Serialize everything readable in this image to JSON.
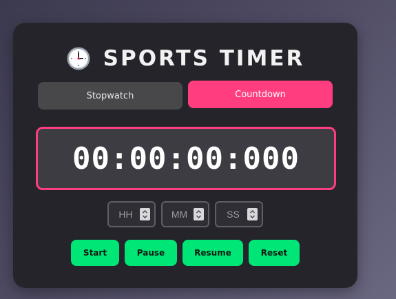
{
  "header": {
    "title": "SPORTS TIMER",
    "icon": "clock-icon"
  },
  "modes": {
    "stopwatch_label": "Stopwatch",
    "countdown_label": "Countdown",
    "active": "Countdown"
  },
  "display": {
    "time": "00:00:00:000"
  },
  "inputs": {
    "hours_placeholder": "HH",
    "minutes_placeholder": "MM",
    "seconds_placeholder": "SS"
  },
  "controls": {
    "start_label": "Start",
    "pause_label": "Pause",
    "resume_label": "Resume",
    "reset_label": "Reset"
  },
  "colors": {
    "accent": "#ff3d7f",
    "action": "#00e676",
    "card": "#25242b"
  }
}
